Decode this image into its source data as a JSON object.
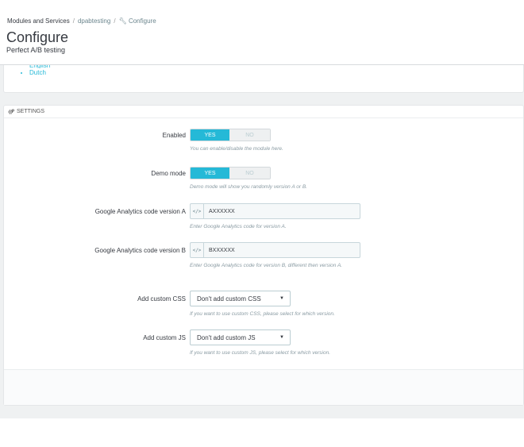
{
  "breadcrumb": {
    "items": [
      "Modules and Services",
      "dpabtesting",
      "Configure"
    ]
  },
  "page": {
    "title": "Configure",
    "subtitle": "Perfect A/B testing"
  },
  "languages": [
    "English",
    "Dutch"
  ],
  "settings": {
    "heading": "Settings",
    "enabled": {
      "label": "Enabled",
      "yes": "YES",
      "no": "NO",
      "value": "YES",
      "help": "You can enable/disable the module here."
    },
    "demo_mode": {
      "label": "Demo mode",
      "yes": "YES",
      "no": "NO",
      "value": "YES",
      "help": "Demo mode will show you randomly version A or B."
    },
    "ga_a": {
      "label": "Google Analytics code version A",
      "addon": "</>",
      "value": "AXXXXXX",
      "help": "Enter Google Analytics code for version A."
    },
    "ga_b": {
      "label": "Google Analytics code version B",
      "addon": "</>",
      "value": "BXXXXXX",
      "help": "Enter Google Analytics code for version B, different then version A."
    },
    "custom_css": {
      "label": "Add custom CSS",
      "selected": "Don't add custom CSS",
      "help": "If you want to use custom CSS, please select for which version."
    },
    "custom_js": {
      "label": "Add custom JS",
      "selected": "Don't add custom JS",
      "help": "If you want to use custom JS, please select for which version."
    }
  },
  "colors": {
    "accent": "#25b9d7",
    "text": "#363a41",
    "help": "#8a9ba3"
  },
  "icons": {
    "settings": "cogs-icon",
    "code": "code-icon",
    "breadcrumb_configure": "wrench-icon",
    "select": "caret-down-icon"
  }
}
